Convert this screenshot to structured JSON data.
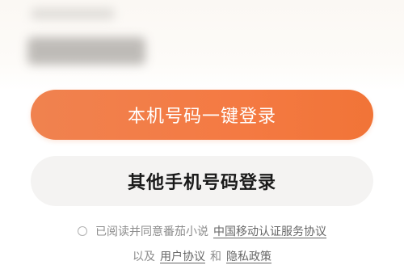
{
  "login": {
    "primary_button_label": "本机号码一键登录",
    "secondary_button_label": "其他手机号码登录"
  },
  "agreement": {
    "prefix": "已阅读并同意番茄小说",
    "carrier_link": "中国移动认证服务协议",
    "and_text": "以及",
    "user_agreement_link": "用户协议",
    "conj": "和",
    "privacy_link": "隐私政策"
  },
  "colors": {
    "accent": "#f47a43",
    "secondary_bg": "#f4f3f2"
  },
  "icons": {
    "agree_checkbox": "radio-circle-icon"
  }
}
